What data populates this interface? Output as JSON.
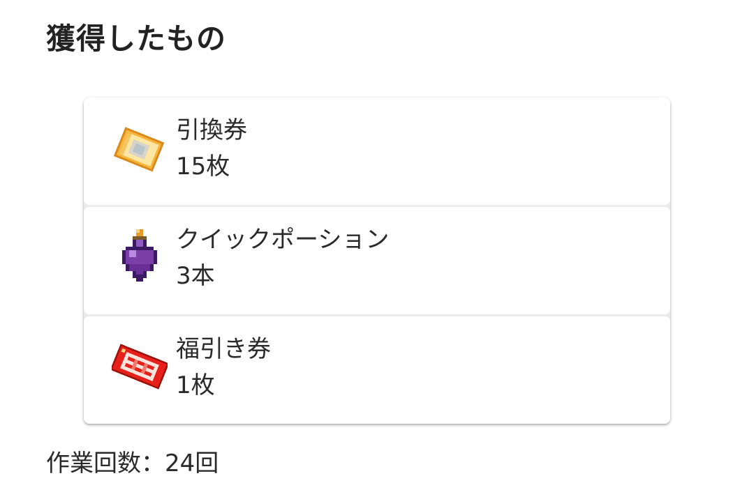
{
  "header": {
    "title": "獲得したもの"
  },
  "items": [
    {
      "name": "引換券",
      "quantity": "15枚",
      "icon": "exchange-ticket-icon",
      "icon_colors": {
        "main": "#f7b53c",
        "light": "#fde7a2",
        "center": "#d9d4c8"
      }
    },
    {
      "name": "クイックポーション",
      "quantity": "3本",
      "icon": "purple-potion-icon",
      "icon_colors": {
        "body": "#7b3fa8",
        "dark": "#3c1a63",
        "cap": "#e39a2a"
      }
    },
    {
      "name": "福引き券",
      "quantity": "1枚",
      "icon": "lottery-ticket-icon",
      "icon_colors": {
        "main": "#e8201c",
        "light": "#fde3dc",
        "dark": "#9c1208"
      }
    }
  ],
  "footer": {
    "work_count_label": "作業回数：24回"
  }
}
